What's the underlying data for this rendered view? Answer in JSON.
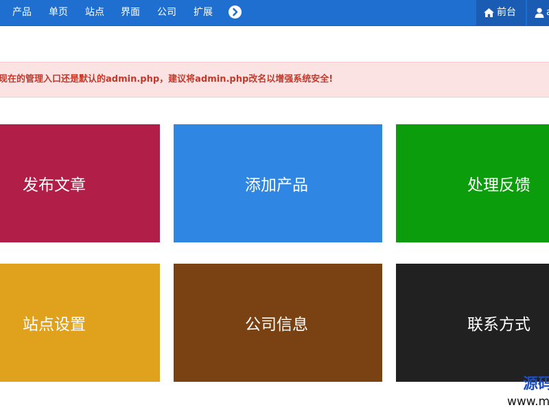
{
  "navbar": {
    "items": [
      "产品",
      "单页",
      "站点",
      "界面",
      "公司",
      "扩展"
    ],
    "more_icon": "chevron-right-circle-icon",
    "frontend_label": "前台",
    "frontend_icon": "home-icon",
    "user_label": "a",
    "user_icon": "user-icon",
    "background_color": "#1f6fd1"
  },
  "alert": {
    "text": "现在的管理入口还是默认的admin.php，建议将admin.php改名以增强系统安全!",
    "background_color": "#fbe3e3",
    "text_color": "#c0392b"
  },
  "tiles": [
    {
      "label": "发布文章",
      "color": "#b11e48"
    },
    {
      "label": "添加产品",
      "color": "#2f86e3"
    },
    {
      "label": "处理反馈",
      "color": "#0b9d0b"
    },
    {
      "label": "站点设置",
      "color": "#e0a21d"
    },
    {
      "label": "公司信息",
      "color": "#7a4212"
    },
    {
      "label": "联系方式",
      "color": "#212121"
    }
  ],
  "watermark": {
    "logo_text": "源码",
    "url_text": "www.m"
  }
}
